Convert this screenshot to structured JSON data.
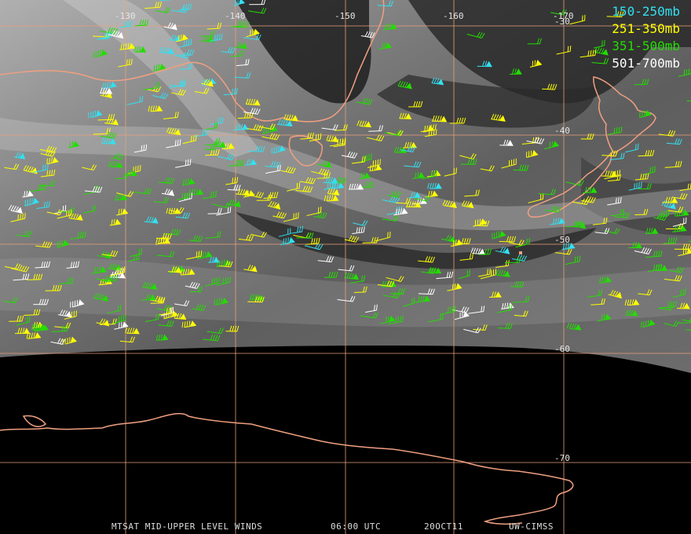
{
  "colors": {
    "grid": "#e8a07a",
    "coast": "#f0a080",
    "space": "#000000",
    "band_150_250": "#33e0f0",
    "band_251_350": "#ffff00",
    "band_351_500": "#22dd00",
    "band_501_700": "#ffffff"
  },
  "graticule": {
    "longitudes": [
      {
        "value": -130,
        "label": "-130"
      },
      {
        "value": -140,
        "label": "-140"
      },
      {
        "value": -150,
        "label": "-150"
      },
      {
        "value": -160,
        "label": "-160"
      },
      {
        "value": -170,
        "label": "-170"
      }
    ],
    "latitudes": [
      {
        "value": -30,
        "label": "-30"
      },
      {
        "value": -40,
        "label": "-40"
      },
      {
        "value": -50,
        "label": "-50"
      },
      {
        "value": -60,
        "label": "-60"
      },
      {
        "value": -70,
        "label": "-70"
      }
    ]
  },
  "legend": [
    {
      "label": "150-250mb",
      "color_key": "band_150_250"
    },
    {
      "label": "251-350mb",
      "color_key": "band_251_350"
    },
    {
      "label": "351-500mb",
      "color_key": "band_351_500"
    },
    {
      "label": "501-700mb",
      "color_key": "band_501_700"
    }
  ],
  "caption": {
    "product": "MTSAT MID-UPPER LEVEL WINDS",
    "time": "06:00 UTC",
    "date": "20OCT11",
    "source": "UW-CIMSS"
  }
}
